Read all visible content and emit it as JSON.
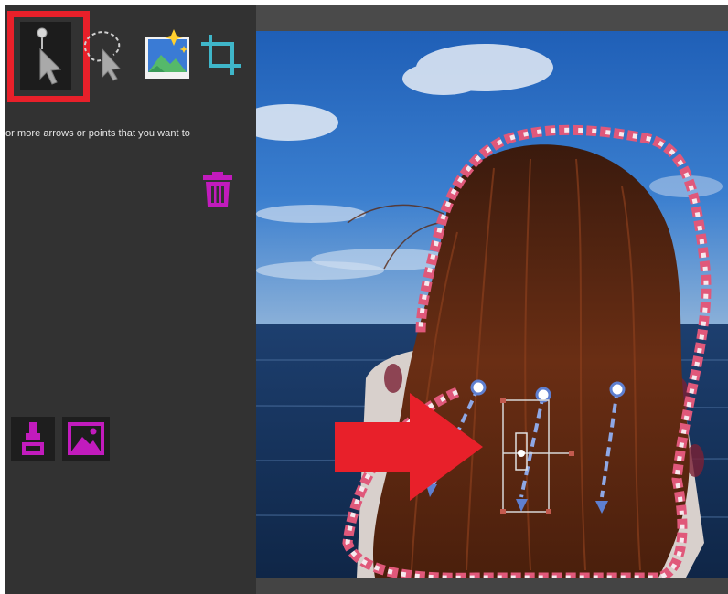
{
  "tools": {
    "point_tool": {
      "icon": "arrow-pointer-icon",
      "selected": true
    },
    "lasso_tool": {
      "icon": "lasso-arrow-icon"
    },
    "photo_tool": {
      "icon": "image-sparkle-icon"
    },
    "crop_tool": {
      "icon": "crop-icon"
    }
  },
  "panel": {
    "hint": "or more arrows or points that you want to"
  },
  "actions": {
    "delete": {
      "icon": "trash-icon",
      "color": "#c21bbd"
    },
    "brush_option": {
      "icon": "brush-icon",
      "color": "#c21bbd"
    },
    "image_option": {
      "icon": "image-icon",
      "color": "#c21bbd"
    }
  },
  "colors": {
    "panel_bg": "#323232",
    "highlight": "#e8202a",
    "accent": "#c21bbd",
    "selection_outline": "#e0587a",
    "arrow_blue": "#8ea8e6"
  }
}
